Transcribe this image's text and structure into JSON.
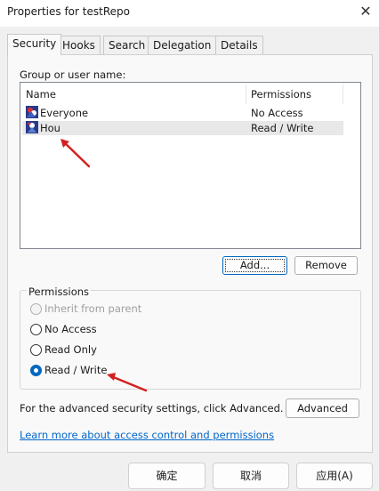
{
  "window": {
    "title": "Properties for testRepo"
  },
  "tabs": [
    {
      "label": "Security"
    },
    {
      "label": "Hooks"
    },
    {
      "label": "Search"
    },
    {
      "label": "Delegation"
    },
    {
      "label": "Details"
    }
  ],
  "security": {
    "group_label": "Group or user name:",
    "columns": {
      "name": "Name",
      "permissions": "Permissions"
    },
    "users": [
      {
        "name": "Everyone",
        "permission": "No Access",
        "selected": false,
        "icon": "users-icon"
      },
      {
        "name": "Hou",
        "permission": "Read / Write",
        "selected": true,
        "icon": "user-icon"
      }
    ],
    "add_label": "Add...",
    "remove_label": "Remove",
    "permissions_label": "Permissions",
    "options": [
      {
        "label": "Inherit from parent",
        "checked": false,
        "disabled": true
      },
      {
        "label": "No Access",
        "checked": false,
        "disabled": false
      },
      {
        "label": "Read Only",
        "checked": false,
        "disabled": false
      },
      {
        "label": "Read / Write",
        "checked": true,
        "disabled": false
      }
    ],
    "advanced_text": "For the advanced security settings, click Advanced.",
    "advanced_label": "Advanced",
    "learn_more": "Learn more about access control and permissions"
  },
  "footer": {
    "ok": "确定",
    "cancel": "取消",
    "apply": "应用(A)"
  },
  "colors": {
    "accent": "#0067c0",
    "arrow": "#d42020",
    "link": "#0066cc"
  }
}
